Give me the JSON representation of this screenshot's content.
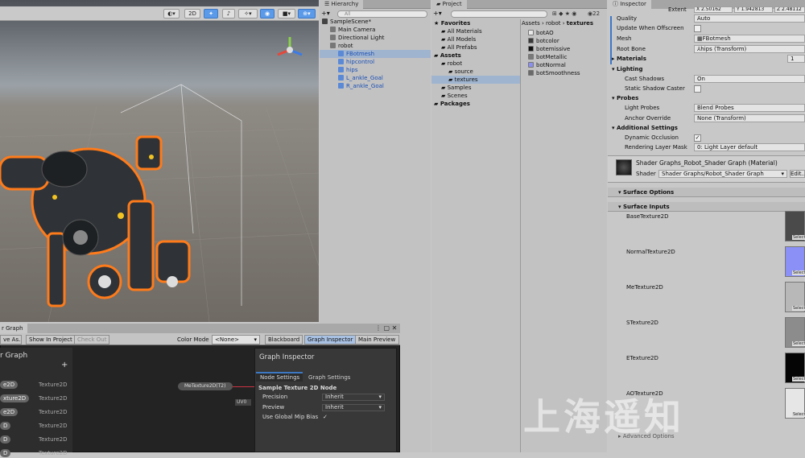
{
  "scene_toolbar": {
    "mode_2d": "2D"
  },
  "hierarchy": {
    "tab": "Hierarchy",
    "search_placeholder": "All",
    "items": [
      {
        "label": "SampleScene*",
        "indent": 0
      },
      {
        "label": "Main Camera",
        "indent": 1
      },
      {
        "label": "Directional Light",
        "indent": 1
      },
      {
        "label": "robot",
        "indent": 1
      },
      {
        "label": "FBotmesh",
        "indent": 2
      },
      {
        "label": "hipcontrol",
        "indent": 2
      },
      {
        "label": "hips",
        "indent": 2
      },
      {
        "label": "L_ankle_Goal",
        "indent": 2
      },
      {
        "label": "R_ankle_Goal",
        "indent": 2
      }
    ]
  },
  "project": {
    "tab": "Project",
    "breadcrumb": [
      "Assets",
      "robot",
      "textures"
    ],
    "count": "22",
    "tree": [
      {
        "label": "Favorites",
        "bold": true
      },
      {
        "label": "All Materials"
      },
      {
        "label": "All Models"
      },
      {
        "label": "All Prefabs"
      },
      {
        "label": "Assets",
        "bold": true
      },
      {
        "label": "robot"
      },
      {
        "label": "source"
      },
      {
        "label": "textures"
      },
      {
        "label": "Samples"
      },
      {
        "label": "Scenes"
      },
      {
        "label": "Packages",
        "bold": true
      }
    ],
    "files": [
      {
        "label": "botAO",
        "color": "#e8e8e8"
      },
      {
        "label": "botcolor",
        "color": "#3a3a3a"
      },
      {
        "label": "botemissive",
        "color": "#101010"
      },
      {
        "label": "botMetallic",
        "color": "#7a7a7a"
      },
      {
        "label": "botNormal",
        "color": "#8a8ff0"
      },
      {
        "label": "botSmoothness",
        "color": "#6a6a6a"
      }
    ]
  },
  "inspector": {
    "tab": "Inspector",
    "extent_label": "Extent",
    "extent": [
      "X 2.50162",
      "Y 1.942813",
      "Z 2.48112"
    ],
    "rows": [
      {
        "label": "Quality",
        "value": "Auto"
      },
      {
        "label": "Update When Offscreen",
        "check": ""
      },
      {
        "label": "Mesh",
        "value": "FBotmesh"
      },
      {
        "label": "Root Bone",
        "value": "hips (Transform)"
      }
    ],
    "materials_label": "Materials",
    "materials_count": "1",
    "lighting_label": "Lighting",
    "lighting_rows": [
      {
        "label": "Cast Shadows",
        "value": "On"
      },
      {
        "label": "Static Shadow Caster",
        "check": ""
      }
    ],
    "probes_label": "Probes",
    "probe_rows": [
      {
        "label": "Light Probes",
        "value": "Blend Probes"
      },
      {
        "label": "Anchor Override",
        "value": "None (Transform)"
      }
    ],
    "additional_label": "Additional Settings",
    "additional_rows": [
      {
        "label": "Dynamic Occlusion",
        "check": "✓"
      },
      {
        "label": "Rendering Layer Mask",
        "value": "0: Light Layer default"
      }
    ],
    "material_title": "Shader Graphs_Robot_Shader Graph (Material)",
    "shader_label": "Shader",
    "shader_value": "Shader Graphs/Robot_Shader Graph",
    "edit_label": "Edit...",
    "surface_options": "Surface Options",
    "surface_inputs": "Surface Inputs",
    "textures": [
      {
        "label": "BaseTexture2D",
        "color": "#4a4a4a"
      },
      {
        "label": "NormalTexture2D",
        "color": "#8a90f5"
      },
      {
        "label": "MeTexture2D",
        "color": "#b8b8b8"
      },
      {
        "label": "STexture2D",
        "color": "#8c8c8c"
      },
      {
        "label": "ETexture2D",
        "color": "#050505"
      },
      {
        "label": "AOTexture2D",
        "color": "#e6e6e6"
      }
    ],
    "thumb_caption": "Select",
    "advanced_options": "Advanced Options"
  },
  "shader_graph": {
    "tab": "r Graph",
    "save_as": "ve As...",
    "show_in_project": "Show In Project",
    "check_out": "Check Out",
    "color_mode_label": "Color Mode",
    "color_mode_value": "<None>",
    "blackboard": "Blackboard",
    "graph_inspector": "Graph Inspector",
    "main_preview": "Main Preview",
    "blackboard_title": "r Graph",
    "add": "+",
    "properties": [
      {
        "pill": "e2D",
        "type": "Texture2D"
      },
      {
        "pill": "xture2D",
        "type": "Texture2D"
      },
      {
        "pill": "e2D",
        "type": "Texture2D"
      },
      {
        "pill": "D",
        "type": "Texture2D"
      },
      {
        "pill": "D",
        "type": "Texture2D"
      },
      {
        "pill": "D",
        "type": "Texture2D"
      }
    ],
    "node_label": "MeTexture2D(T2)",
    "uv_label": "UV0",
    "inspector_title": "Graph Inspector",
    "node_settings_tab": "Node Settings",
    "graph_settings_tab": "Graph Settings",
    "node_title": "Sample Texture 2D Node",
    "settings": [
      {
        "label": "Precision",
        "value": "Inherit"
      },
      {
        "label": "Preview",
        "value": "Inherit"
      }
    ],
    "mip_label": "Use Global Mip Bias",
    "mip_check": "✓"
  },
  "watermark": "上海遥知"
}
